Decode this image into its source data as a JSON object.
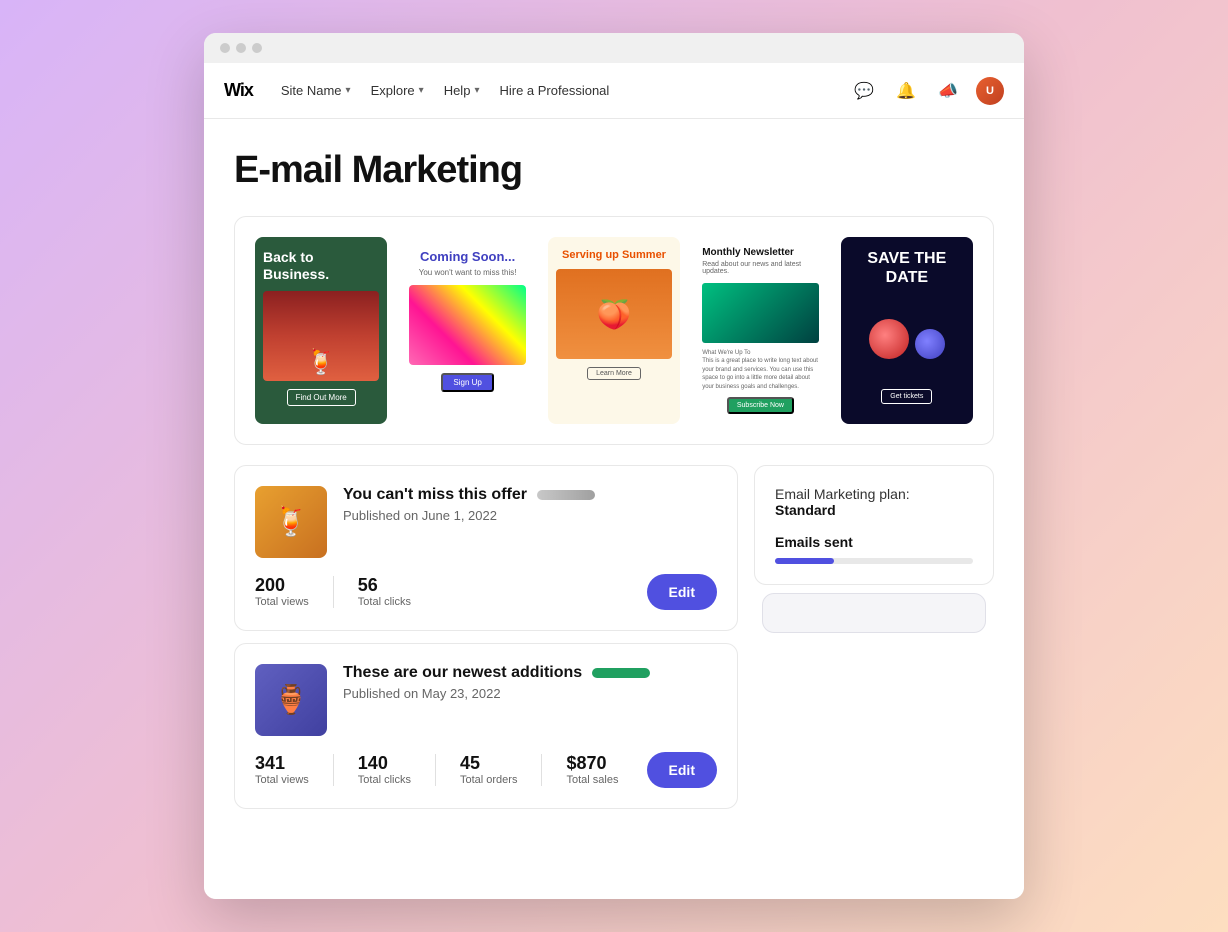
{
  "browser": {
    "dots": [
      "dot1",
      "dot2",
      "dot3"
    ]
  },
  "navbar": {
    "logo": "Wix",
    "site_name": "Site Name",
    "explore": "Explore",
    "help": "Help",
    "hire": "Hire a Professional",
    "avatar_initials": "U"
  },
  "page": {
    "title": "E-mail Marketing"
  },
  "templates": [
    {
      "id": "card1",
      "name": "back-to-business",
      "headline": "Back to Business.",
      "button": "Find Out More"
    },
    {
      "id": "card2",
      "name": "coming-soon",
      "headline": "Coming Soon...",
      "subtitle": "You won't want to miss this!",
      "button": "Sign Up"
    },
    {
      "id": "card3",
      "name": "serving-summer",
      "headline": "Serving up Summer",
      "button": "Learn More"
    },
    {
      "id": "card4",
      "name": "monthly-newsletter",
      "headline": "Monthly Newsletter",
      "subtitle": "Read about our news and latest updates.",
      "section": "What We're Up To",
      "button": "Subscribe Now"
    },
    {
      "id": "card5",
      "name": "save-the-date",
      "headline": "SAVE THE DATE",
      "button": "Get tickets"
    }
  ],
  "campaigns": [
    {
      "id": "campaign1",
      "name": "You can't miss this offer",
      "published": "Published on June 1, 2022",
      "status": "pending",
      "stats": {
        "views": "200",
        "views_label": "Total views",
        "clicks": "56",
        "clicks_label": "Total clicks"
      },
      "edit_button": "Edit"
    },
    {
      "id": "campaign2",
      "name": "These are our newest additions",
      "published": "Published on May 23, 2022",
      "status": "active",
      "stats": {
        "views": "341",
        "views_label": "Total views",
        "clicks": "140",
        "clicks_label": "Total clicks",
        "orders": "45",
        "orders_label": "Total orders",
        "sales": "$870",
        "sales_label": "Total sales"
      },
      "edit_button": "Edit"
    }
  ],
  "sidebar": {
    "plan_label": "Email Marketing plan:",
    "plan_name": "Standard",
    "emails_sent": "Emails sent",
    "progress_pct": 30
  }
}
